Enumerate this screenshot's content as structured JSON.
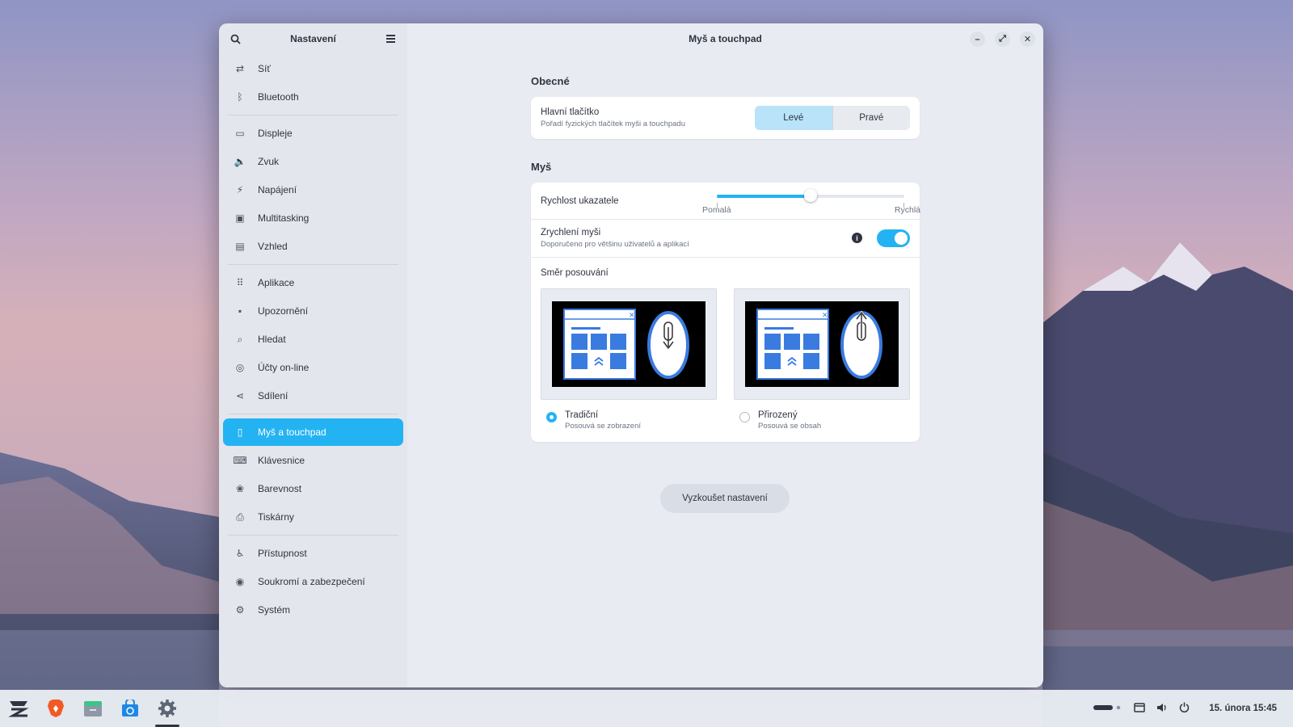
{
  "sidebar": {
    "title": "Nastavení",
    "search_icon": "search-icon",
    "menu_icon": "hamburger-menu-icon",
    "items": [
      {
        "label": "Síť",
        "icon": "network-icon",
        "glyph": "⇄"
      },
      {
        "label": "Bluetooth",
        "icon": "bluetooth-icon",
        "glyph": "ᛒ"
      },
      {
        "label": "Displeje",
        "icon": "display-icon",
        "glyph": "▭"
      },
      {
        "label": "Zvuk",
        "icon": "speaker-icon",
        "glyph": "🔈"
      },
      {
        "label": "Napájení",
        "icon": "power-icon",
        "glyph": "⚡"
      },
      {
        "label": "Multitasking",
        "icon": "multitasking-icon",
        "glyph": "▣"
      },
      {
        "label": "Vzhled",
        "icon": "appearance-icon",
        "glyph": "▤"
      },
      {
        "label": "Aplikace",
        "icon": "apps-grid-icon",
        "glyph": "⠿"
      },
      {
        "label": "Upozornění",
        "icon": "notifications-icon",
        "glyph": "▪"
      },
      {
        "label": "Hledat",
        "icon": "search-icon",
        "glyph": "⌕"
      },
      {
        "label": "Účty on-line",
        "icon": "online-accounts-icon",
        "glyph": "◎"
      },
      {
        "label": "Sdílení",
        "icon": "share-icon",
        "glyph": "⋖"
      },
      {
        "label": "Myš a touchpad",
        "icon": "mouse-icon",
        "glyph": "▯"
      },
      {
        "label": "Klávesnice",
        "icon": "keyboard-icon",
        "glyph": "⌨"
      },
      {
        "label": "Barevnost",
        "icon": "color-icon",
        "glyph": "❀"
      },
      {
        "label": "Tiskárny",
        "icon": "printer-icon",
        "glyph": "⎙"
      },
      {
        "label": "Přístupnost",
        "icon": "accessibility-icon",
        "glyph": "♿"
      },
      {
        "label": "Soukromí a zabezpečení",
        "icon": "privacy-icon",
        "glyph": "◉"
      },
      {
        "label": "Systém",
        "icon": "gear-icon",
        "glyph": "⚙"
      }
    ]
  },
  "window": {
    "title": "Myš a touchpad",
    "minimize_glyph": "–",
    "maximize_glyph": "⤢",
    "close_glyph": "✕"
  },
  "general": {
    "section_title": "Obecné",
    "primary_button_label": "Hlavní tlačítko",
    "primary_button_sub": "Pořadí fyzických tlačítek myši a touchpadu",
    "left_label": "Levé",
    "right_label": "Pravé",
    "selected": "Levé"
  },
  "mouse": {
    "section_title": "Myš",
    "speed_label": "Rychlost ukazatele",
    "speed_min_label": "Pomalá",
    "speed_max_label": "Rychlá",
    "speed_value": 0.5,
    "accel_label": "Zrychlení myši",
    "accel_sub": "Doporučeno pro většinu uživatelů a aplikací",
    "accel_info_glyph": "i",
    "accel_enabled": true,
    "scroll_title": "Směr posouvání",
    "traditional_label": "Tradiční",
    "traditional_sub": "Posouvá se zobrazení",
    "natural_label": "Přirozený",
    "natural_sub": "Posouvá se obsah",
    "scroll_selected": "Tradiční"
  },
  "test_button_label": "Vyzkoušet nastavení",
  "taskbar": {
    "apps": [
      "zorin-menu-icon",
      "brave-browser-icon",
      "files-icon",
      "software-store-icon",
      "settings-gear-icon"
    ],
    "clock": "15. února 15:45"
  },
  "colors": {
    "accent": "#24b3f2",
    "selected_segment": "#b9e3f9"
  }
}
